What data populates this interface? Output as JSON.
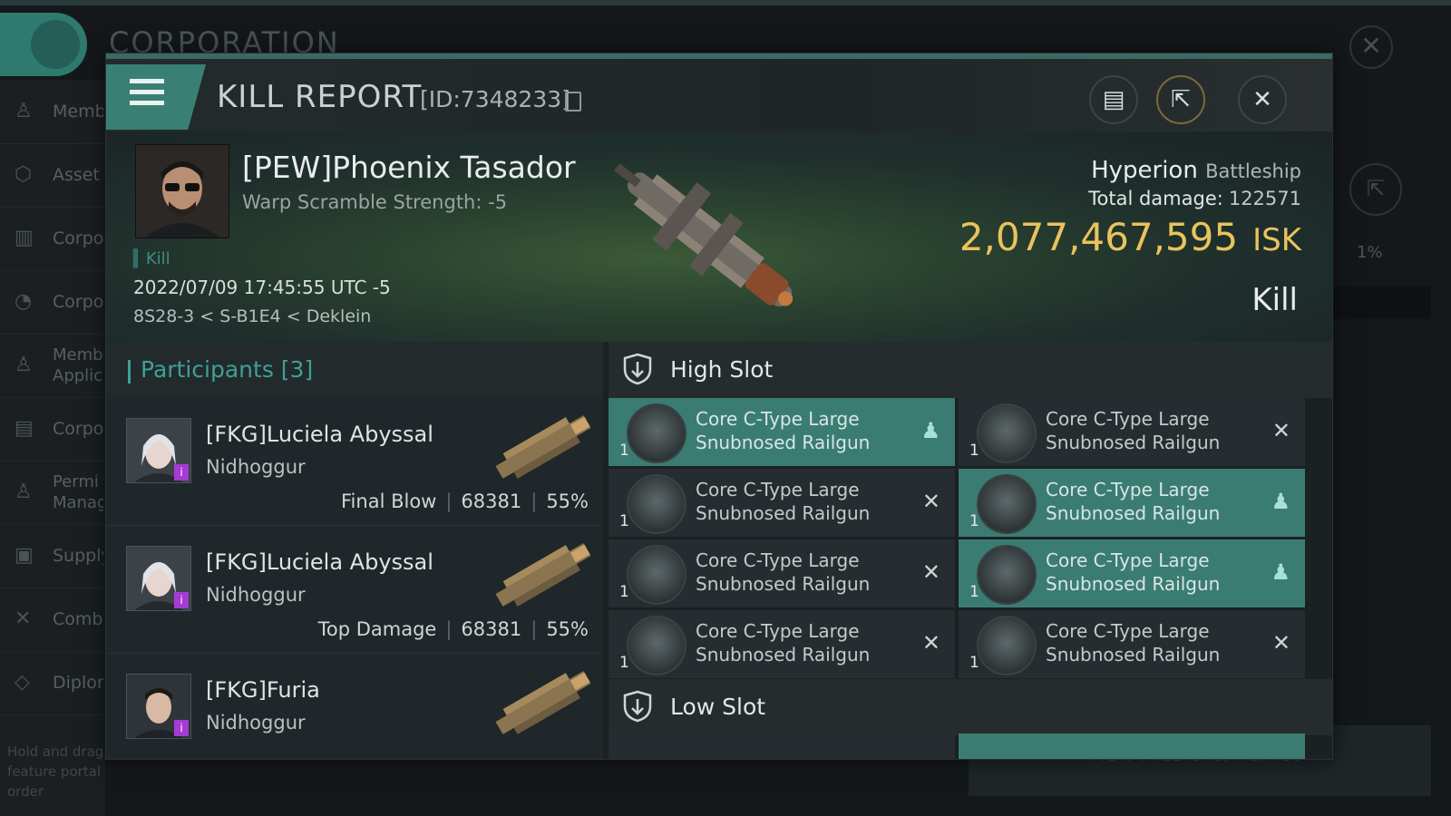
{
  "background": {
    "title": "CORPORATION",
    "sidebar": [
      {
        "label": "Memb"
      },
      {
        "label": "Asset"
      },
      {
        "label": "Corpo"
      },
      {
        "label": "Corpo"
      },
      {
        "label": "Memb Applic"
      },
      {
        "label": "Corpo"
      },
      {
        "label": "Permi Manag"
      },
      {
        "label": "Supply"
      },
      {
        "label": "Comb"
      },
      {
        "label": "Diplon"
      }
    ],
    "hint": "Hold and drag feature portal order",
    "percent": "1%",
    "market_button": "View Missions/Market"
  },
  "header": {
    "title": "KILL REPORT",
    "id": "[ID:7348233]"
  },
  "victim": {
    "name": "[PEW]Phoenix Tasador",
    "subtitle": "Warp Scramble Strength: -5",
    "tag": "Kill",
    "datetime": "2022/07/09 17:45:55 UTC -5",
    "location": "8S28-3 < S-B1E4 < Deklein",
    "ship_name": "Hyperion",
    "ship_class": "Battleship",
    "total_damage_label": "Total damage:",
    "total_damage": "122571",
    "isk_value": "2,077,467,595",
    "isk_unit": "ISK",
    "status": "Kill"
  },
  "participants": {
    "title": "Participants [3]",
    "items": [
      {
        "name": "[FKG]Luciela Abyssal",
        "ship": "Nidhoggur",
        "role": "Final Blow",
        "damage": "68381",
        "percent": "55%"
      },
      {
        "name": "[FKG]Luciela Abyssal",
        "ship": "Nidhoggur",
        "role": "Top Damage",
        "damage": "68381",
        "percent": "55%"
      },
      {
        "name": "[FKG]Furia",
        "ship": "Nidhoggur"
      }
    ]
  },
  "slots": {
    "high_title": "High Slot",
    "low_title": "Low Slot",
    "high_modules": [
      {
        "name": "Core C-Type Large Snubnosed Railgun",
        "qty": "1",
        "state": "dropped"
      },
      {
        "name": "Core C-Type Large Snubnosed Railgun",
        "qty": "1",
        "state": "destroyed"
      },
      {
        "name": "Core C-Type Large Snubnosed Railgun",
        "qty": "1",
        "state": "destroyed"
      },
      {
        "name": "Core C-Type Large Snubnosed Railgun",
        "qty": "1",
        "state": "dropped"
      },
      {
        "name": "Core C-Type Large Snubnosed Railgun",
        "qty": "1",
        "state": "destroyed"
      },
      {
        "name": "Core C-Type Large Snubnosed Railgun",
        "qty": "1",
        "state": "dropped"
      },
      {
        "name": "Core C-Type Large Snubnosed Railgun",
        "qty": "1",
        "state": "destroyed"
      },
      {
        "name": "Core C-Type Large Snubnosed Railgun",
        "qty": "1",
        "state": "destroyed"
      }
    ]
  },
  "colors": {
    "accent": "#3da195",
    "highlight_row": "#3b7c72",
    "isk": "#e9c35c"
  }
}
